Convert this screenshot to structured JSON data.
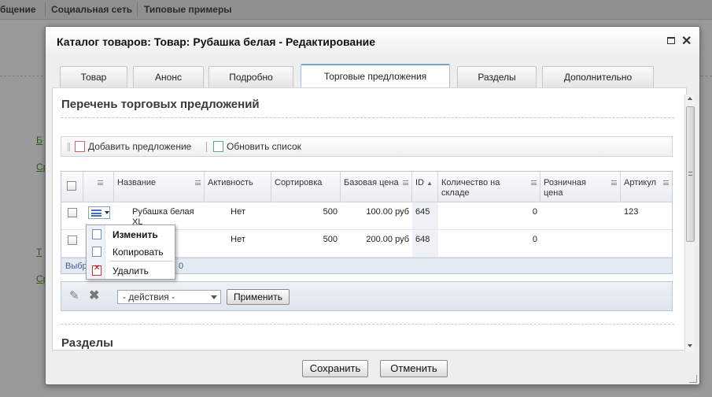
{
  "background": {
    "top_links": [
      "бщение",
      "Социальная сеть",
      "Типовые примеры"
    ],
    "side_links": [
      "Б",
      "Ср",
      "Т",
      "Ср"
    ]
  },
  "dialog": {
    "title": "Каталог товаров: Товар: Рубашка белая - Редактирование",
    "tabs": [
      "Товар",
      "Анонс",
      "Подробно",
      "Торговые предложения",
      "Разделы",
      "Дополнительно"
    ],
    "active_tab": "Торговые предложения",
    "section_title": "Перечень торговых предложений",
    "toolbar": {
      "add_label": "Добавить предложение",
      "refresh_label": "Обновить список"
    },
    "grid": {
      "columns": [
        "Название",
        "Активность",
        "Сортировка",
        "Базовая цена",
        "ID",
        "Количество на складе",
        "Розничная цена",
        "Артикул"
      ],
      "sort_indicator": "▲",
      "rows": [
        {
          "name": "Рубашка белая XL",
          "active": "Нет",
          "sort": "500",
          "price": "100.00 руб",
          "id": "645",
          "qty": "0",
          "retail": "",
          "sku": "123"
        },
        {
          "name": "",
          "active": "Нет",
          "sort": "500",
          "price": "200.00 руб",
          "id": "648",
          "qty": "0",
          "retail": "",
          "sku": ""
        }
      ],
      "footer_left": "Выбр",
      "footer_value": "0"
    },
    "actions": {
      "select_value": "- действия -",
      "apply_label": "Применить"
    },
    "section2_title": "Разделы",
    "buttons": {
      "save": "Сохранить",
      "cancel": "Отменить"
    }
  },
  "context_menu": {
    "items": [
      "Изменить",
      "Копировать",
      "Удалить"
    ]
  },
  "colors": {
    "accent": "#7ea2c8",
    "link": "#2c5b12",
    "overlay": "#9a9a9a"
  }
}
